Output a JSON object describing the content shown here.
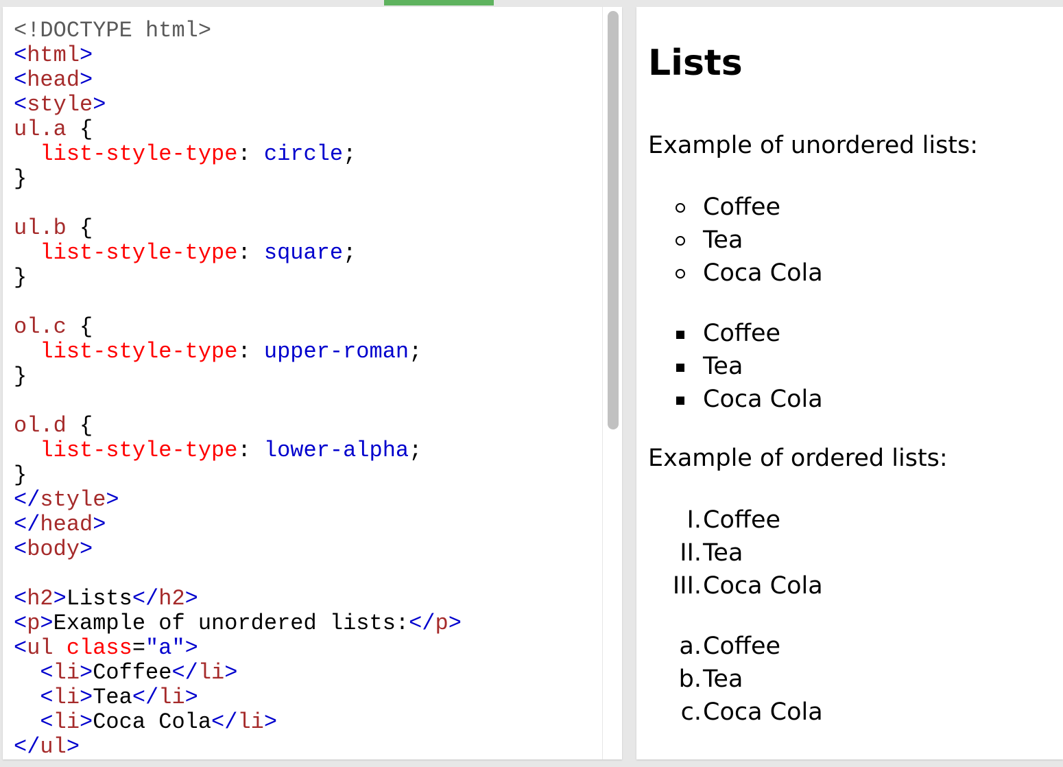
{
  "editor": {
    "lines": [
      [
        {
          "c": "tok-doctype",
          "t": "<!DOCTYPE html>"
        }
      ],
      [
        {
          "c": "tok-bracket",
          "t": "<"
        },
        {
          "c": "tok-tag",
          "t": "html"
        },
        {
          "c": "tok-bracket",
          "t": ">"
        }
      ],
      [
        {
          "c": "tok-bracket",
          "t": "<"
        },
        {
          "c": "tok-tag",
          "t": "head"
        },
        {
          "c": "tok-bracket",
          "t": ">"
        }
      ],
      [
        {
          "c": "tok-bracket",
          "t": "<"
        },
        {
          "c": "tok-tag",
          "t": "style"
        },
        {
          "c": "tok-bracket",
          "t": ">"
        }
      ],
      [
        {
          "c": "tok-selector",
          "t": "ul.a"
        },
        {
          "c": "tok-punct",
          "t": " {"
        }
      ],
      [
        {
          "c": "tok-punct",
          "t": "  "
        },
        {
          "c": "tok-prop",
          "t": "list-style-type"
        },
        {
          "c": "tok-punct",
          "t": ": "
        },
        {
          "c": "tok-value",
          "t": "circle"
        },
        {
          "c": "tok-punct",
          "t": ";"
        }
      ],
      [
        {
          "c": "tok-punct",
          "t": "}"
        }
      ],
      [],
      [
        {
          "c": "tok-selector",
          "t": "ul.b"
        },
        {
          "c": "tok-punct",
          "t": " {"
        }
      ],
      [
        {
          "c": "tok-punct",
          "t": "  "
        },
        {
          "c": "tok-prop",
          "t": "list-style-type"
        },
        {
          "c": "tok-punct",
          "t": ": "
        },
        {
          "c": "tok-value",
          "t": "square"
        },
        {
          "c": "tok-punct",
          "t": ";"
        }
      ],
      [
        {
          "c": "tok-punct",
          "t": "}"
        }
      ],
      [],
      [
        {
          "c": "tok-selector",
          "t": "ol.c"
        },
        {
          "c": "tok-punct",
          "t": " {"
        }
      ],
      [
        {
          "c": "tok-punct",
          "t": "  "
        },
        {
          "c": "tok-prop",
          "t": "list-style-type"
        },
        {
          "c": "tok-punct",
          "t": ": "
        },
        {
          "c": "tok-value",
          "t": "upper-roman"
        },
        {
          "c": "tok-punct",
          "t": ";"
        }
      ],
      [
        {
          "c": "tok-punct",
          "t": "}"
        }
      ],
      [],
      [
        {
          "c": "tok-selector",
          "t": "ol.d"
        },
        {
          "c": "tok-punct",
          "t": " {"
        }
      ],
      [
        {
          "c": "tok-punct",
          "t": "  "
        },
        {
          "c": "tok-prop",
          "t": "list-style-type"
        },
        {
          "c": "tok-punct",
          "t": ": "
        },
        {
          "c": "tok-value",
          "t": "lower-alpha"
        },
        {
          "c": "tok-punct",
          "t": ";"
        }
      ],
      [
        {
          "c": "tok-punct",
          "t": "}"
        }
      ],
      [
        {
          "c": "tok-bracket",
          "t": "</"
        },
        {
          "c": "tok-tag",
          "t": "style"
        },
        {
          "c": "tok-bracket",
          "t": ">"
        }
      ],
      [
        {
          "c": "tok-bracket",
          "t": "</"
        },
        {
          "c": "tok-tag",
          "t": "head"
        },
        {
          "c": "tok-bracket",
          "t": ">"
        }
      ],
      [
        {
          "c": "tok-bracket",
          "t": "<"
        },
        {
          "c": "tok-tag",
          "t": "body"
        },
        {
          "c": "tok-bracket",
          "t": ">"
        }
      ],
      [],
      [
        {
          "c": "tok-bracket",
          "t": "<"
        },
        {
          "c": "tok-tag",
          "t": "h2"
        },
        {
          "c": "tok-bracket",
          "t": ">"
        },
        {
          "c": "tok-text",
          "t": "Lists"
        },
        {
          "c": "tok-bracket",
          "t": "</"
        },
        {
          "c": "tok-tag",
          "t": "h2"
        },
        {
          "c": "tok-bracket",
          "t": ">"
        }
      ],
      [
        {
          "c": "tok-bracket",
          "t": "<"
        },
        {
          "c": "tok-tag",
          "t": "p"
        },
        {
          "c": "tok-bracket",
          "t": ">"
        },
        {
          "c": "tok-text",
          "t": "Example of unordered lists:"
        },
        {
          "c": "tok-bracket",
          "t": "</"
        },
        {
          "c": "tok-tag",
          "t": "p"
        },
        {
          "c": "tok-bracket",
          "t": ">"
        }
      ],
      [
        {
          "c": "tok-bracket",
          "t": "<"
        },
        {
          "c": "tok-tag",
          "t": "ul"
        },
        {
          "c": "tok-punct",
          "t": " "
        },
        {
          "c": "tok-attr",
          "t": "class"
        },
        {
          "c": "tok-punct",
          "t": "="
        },
        {
          "c": "tok-attrval",
          "t": "\"a\""
        },
        {
          "c": "tok-bracket",
          "t": ">"
        }
      ],
      [
        {
          "c": "tok-punct",
          "t": "  "
        },
        {
          "c": "tok-bracket",
          "t": "<"
        },
        {
          "c": "tok-tag",
          "t": "li"
        },
        {
          "c": "tok-bracket",
          "t": ">"
        },
        {
          "c": "tok-text",
          "t": "Coffee"
        },
        {
          "c": "tok-bracket",
          "t": "</"
        },
        {
          "c": "tok-tag",
          "t": "li"
        },
        {
          "c": "tok-bracket",
          "t": ">"
        }
      ],
      [
        {
          "c": "tok-punct",
          "t": "  "
        },
        {
          "c": "tok-bracket",
          "t": "<"
        },
        {
          "c": "tok-tag",
          "t": "li"
        },
        {
          "c": "tok-bracket",
          "t": ">"
        },
        {
          "c": "tok-text",
          "t": "Tea"
        },
        {
          "c": "tok-bracket",
          "t": "</"
        },
        {
          "c": "tok-tag",
          "t": "li"
        },
        {
          "c": "tok-bracket",
          "t": ">"
        }
      ],
      [
        {
          "c": "tok-punct",
          "t": "  "
        },
        {
          "c": "tok-bracket",
          "t": "<"
        },
        {
          "c": "tok-tag",
          "t": "li"
        },
        {
          "c": "tok-bracket",
          "t": ">"
        },
        {
          "c": "tok-text",
          "t": "Coca Cola"
        },
        {
          "c": "tok-bracket",
          "t": "</"
        },
        {
          "c": "tok-tag",
          "t": "li"
        },
        {
          "c": "tok-bracket",
          "t": ">"
        }
      ],
      [
        {
          "c": "tok-bracket",
          "t": "</"
        },
        {
          "c": "tok-tag",
          "t": "ul"
        },
        {
          "c": "tok-bracket",
          "t": ">"
        }
      ]
    ]
  },
  "preview": {
    "title": "Lists",
    "unordered_intro": "Example of unordered lists:",
    "ordered_intro": "Example of ordered lists:",
    "list_a": {
      "marker_type": "circle",
      "items": [
        "Coffee",
        "Tea",
        "Coca Cola"
      ]
    },
    "list_b": {
      "marker_type": "square",
      "items": [
        "Coffee",
        "Tea",
        "Coca Cola"
      ]
    },
    "list_c": {
      "markers": [
        "I.",
        "II.",
        "III."
      ],
      "items": [
        "Coffee",
        "Tea",
        "Coca Cola"
      ]
    },
    "list_d": {
      "markers": [
        "a.",
        "b.",
        "c."
      ],
      "items": [
        "Coffee",
        "Tea",
        "Coca Cola"
      ]
    }
  },
  "colors": {
    "accent_green": "#5fb35f",
    "code_bracket": "#0000cd",
    "code_tag": "#a52a2a",
    "code_property": "#ff0000",
    "code_value": "#0000cd",
    "scrollbar_thumb": "#c1c1c1"
  }
}
